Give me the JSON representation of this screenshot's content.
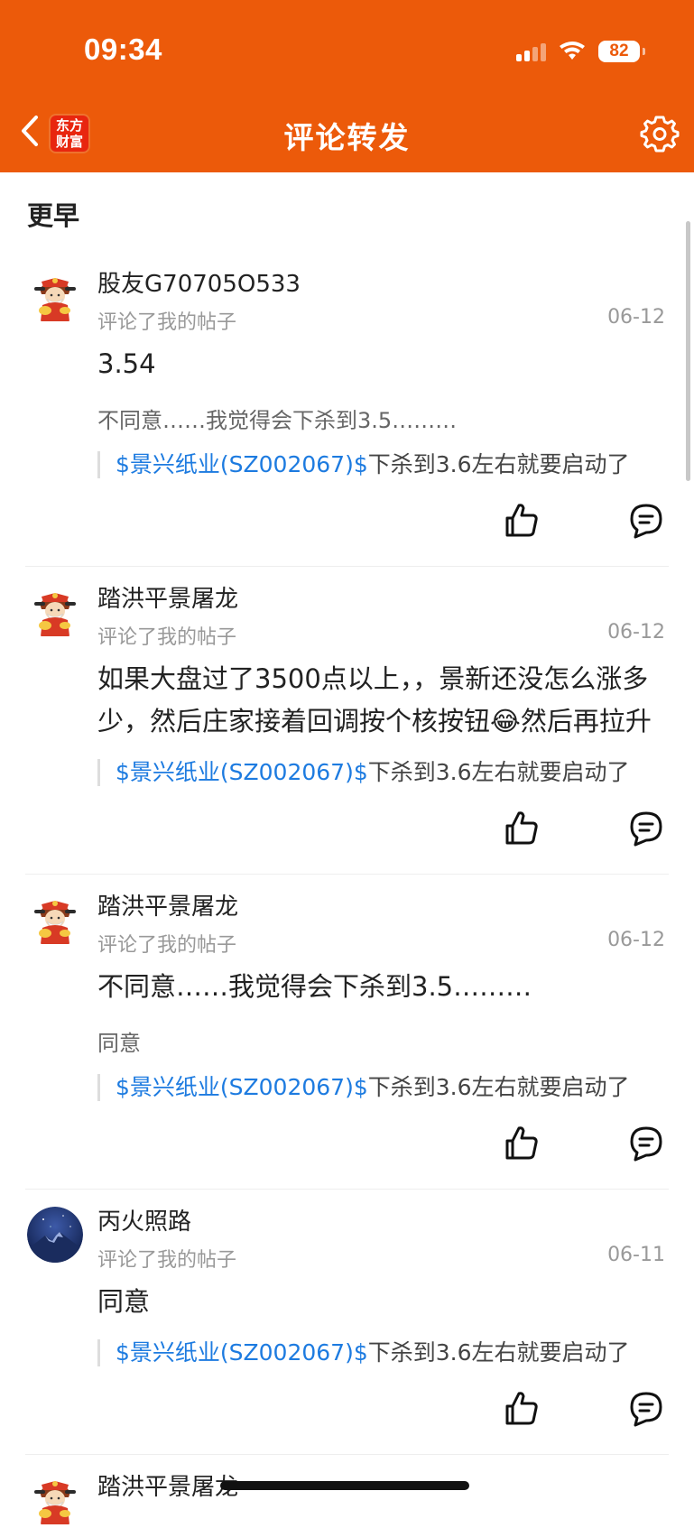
{
  "status_bar": {
    "time": "09:34",
    "battery": "82"
  },
  "header": {
    "title": "评论转发",
    "logo_line1": "东方",
    "logo_line2": "财富"
  },
  "section_title": "更早",
  "items": [
    {
      "name": "股友G70705O533",
      "action": "评论了我的帖子",
      "date": "06-12",
      "content": "3.54",
      "sub": "不同意……我觉得会下杀到3.5………",
      "stock": "$景兴纸业(SZ002067)$",
      "quote_text": "下杀到3.6左右就要启动了",
      "avatar": "fortune-god-icon"
    },
    {
      "name": "踏洪平景屠龙",
      "action": "评论了我的帖子",
      "date": "06-12",
      "content": "如果大盘过了3500点以上，，景新还没怎么涨多少，然后庄家接着回调按个核按钮😂然后再拉升",
      "stock": "$景兴纸业(SZ002067)$",
      "quote_text": "下杀到3.6左右就要启动了",
      "avatar": "fortune-god-icon"
    },
    {
      "name": "踏洪平景屠龙",
      "action": "评论了我的帖子",
      "date": "06-12",
      "content": "不同意……我觉得会下杀到3.5………",
      "sub": "同意",
      "stock": "$景兴纸业(SZ002067)$",
      "quote_text": "下杀到3.6左右就要启动了",
      "avatar": "fortune-god-icon"
    },
    {
      "name": "丙火照路",
      "action": "评论了我的帖子",
      "date": "06-11",
      "content": "同意",
      "stock": "$景兴纸业(SZ002067)$",
      "quote_text": "下杀到3.6左右就要启动了",
      "avatar": "mountain-night-icon"
    },
    {
      "name": "踏洪平景屠龙",
      "avatar": "fortune-god-icon"
    }
  ],
  "colors": {
    "brand": "#ec5a0a",
    "link": "#1d7be0"
  }
}
